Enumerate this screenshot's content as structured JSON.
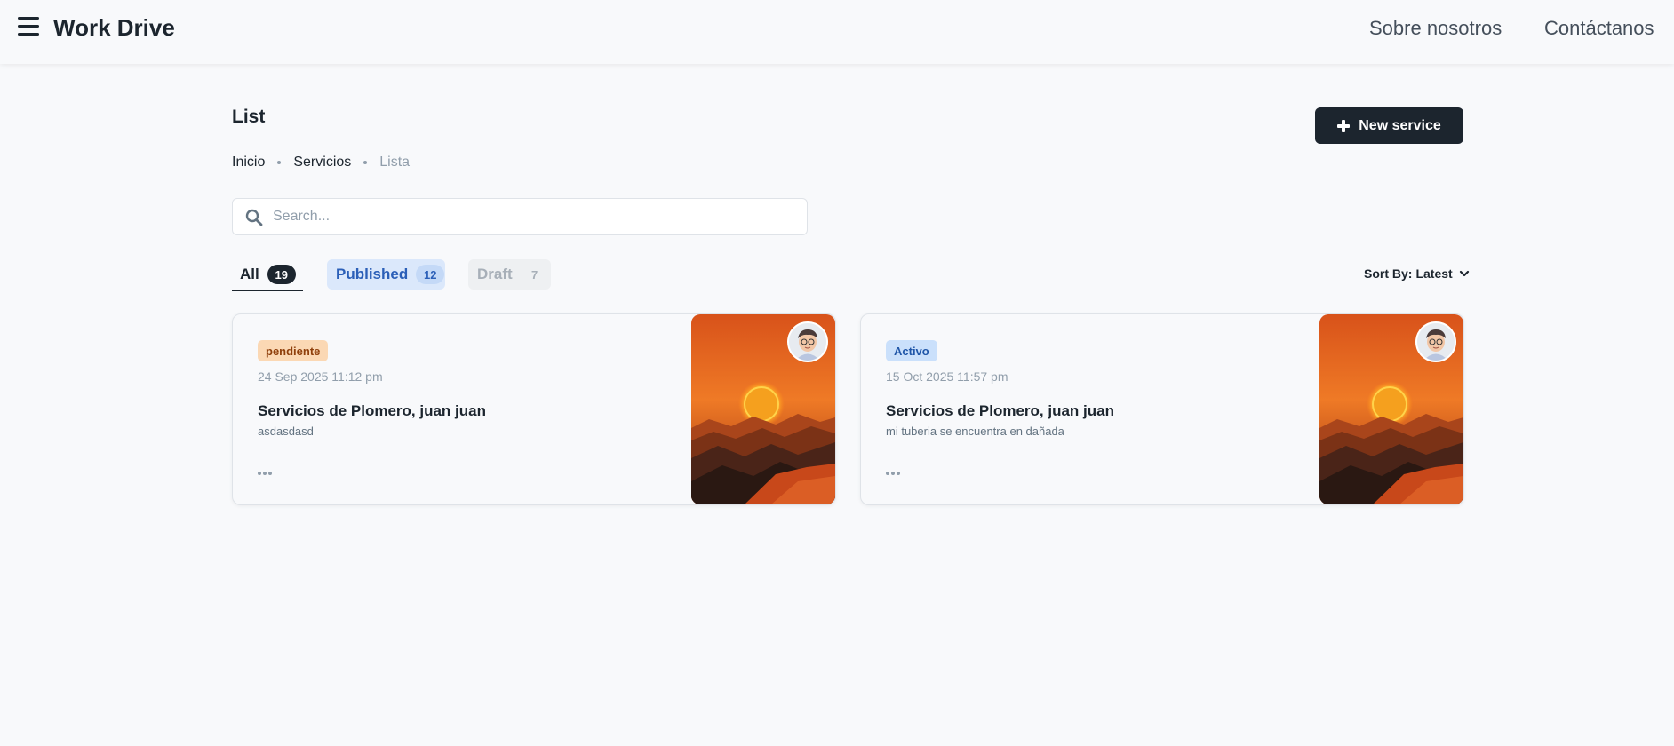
{
  "header": {
    "app_title": "Work Drive",
    "nav": [
      "Sobre nosotros",
      "Contáctanos"
    ]
  },
  "page": {
    "title": "List",
    "breadcrumb": [
      "Inicio",
      "Servicios",
      "Lista"
    ],
    "new_button_label": "New service"
  },
  "search": {
    "placeholder": "Search...",
    "value": ""
  },
  "tabs": [
    {
      "label": "All",
      "count": "19",
      "active": true
    },
    {
      "label": "Published",
      "count": "12"
    },
    {
      "label": "Draft",
      "count": "7"
    }
  ],
  "sort": {
    "label": "Sort By:",
    "value": "Latest"
  },
  "cards": [
    {
      "status": "pendiente",
      "status_color": "#fbd8b4",
      "date": "24 Sep 2025 11:12 pm",
      "title": "Servicios de Plomero, juan juan",
      "description": "asdasdasd"
    },
    {
      "status": "Activo",
      "status_color": "#cae0fb",
      "date": "15 Oct 2025 11:57 pm",
      "title": "Servicios de Plomero, juan juan",
      "description": "mi tuberia se encuentra en dañada"
    }
  ],
  "colors": {
    "primary_dark": "#1c252e",
    "background": "#f8f9fb",
    "published_blue": "#2b5fb8"
  }
}
